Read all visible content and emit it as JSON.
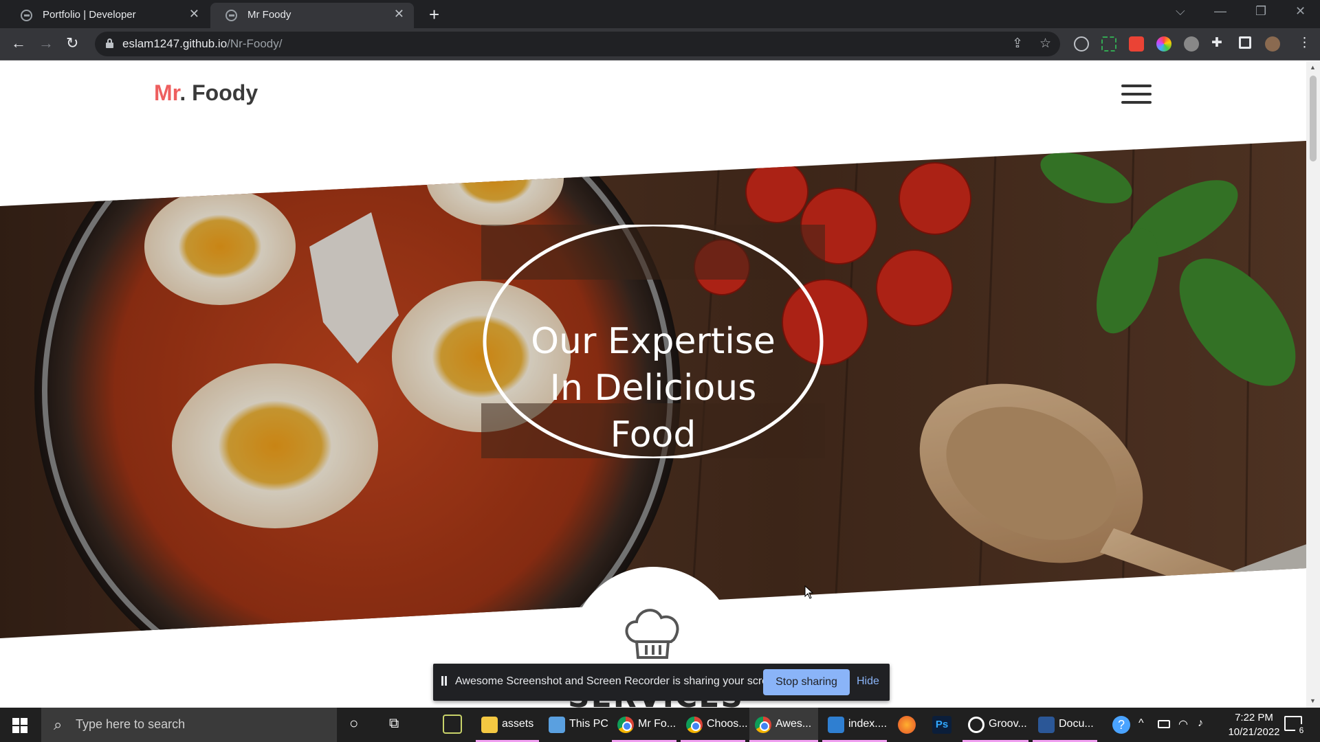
{
  "browser": {
    "tabs": [
      {
        "title": "Portfolio | Developer",
        "active": false
      },
      {
        "title": "Mr Foody",
        "active": true
      }
    ],
    "url_host": "eslam1247.github.io",
    "url_path": "/Nr-Foody/",
    "new_tab": "+",
    "close_glyph": "✕"
  },
  "site": {
    "logo_prefix": "Mr",
    "logo_dot": ".",
    "logo_name": " Foody",
    "hero_title": [
      "Our Expertise",
      "In Delicious",
      "Food"
    ],
    "section_title": "SERVICES",
    "colors": {
      "accent": "#ee5f5f",
      "text": "#3a3a3a"
    }
  },
  "share_banner": {
    "message": "Awesome Screenshot and Screen Recorder is sharing your screen.",
    "stop_label": "Stop sharing",
    "hide_label": "Hide"
  },
  "taskbar": {
    "search_placeholder": "Type here to search",
    "apps": [
      {
        "label": "assets",
        "icon": "folder-icon"
      },
      {
        "label": "This PC",
        "icon": "computer-icon"
      },
      {
        "label": "Mr Fo...",
        "icon": "chrome-icon"
      },
      {
        "label": "Choos...",
        "icon": "chrome-icon"
      },
      {
        "label": "Awes...",
        "icon": "chrome-icon"
      },
      {
        "label": "index....",
        "icon": "vscode-icon"
      },
      {
        "label": "Groov...",
        "icon": "groove-icon"
      },
      {
        "label": "Docu...",
        "icon": "word-icon"
      }
    ],
    "time": "7:22 PM",
    "date": "10/21/2022",
    "notification_count": "6"
  }
}
